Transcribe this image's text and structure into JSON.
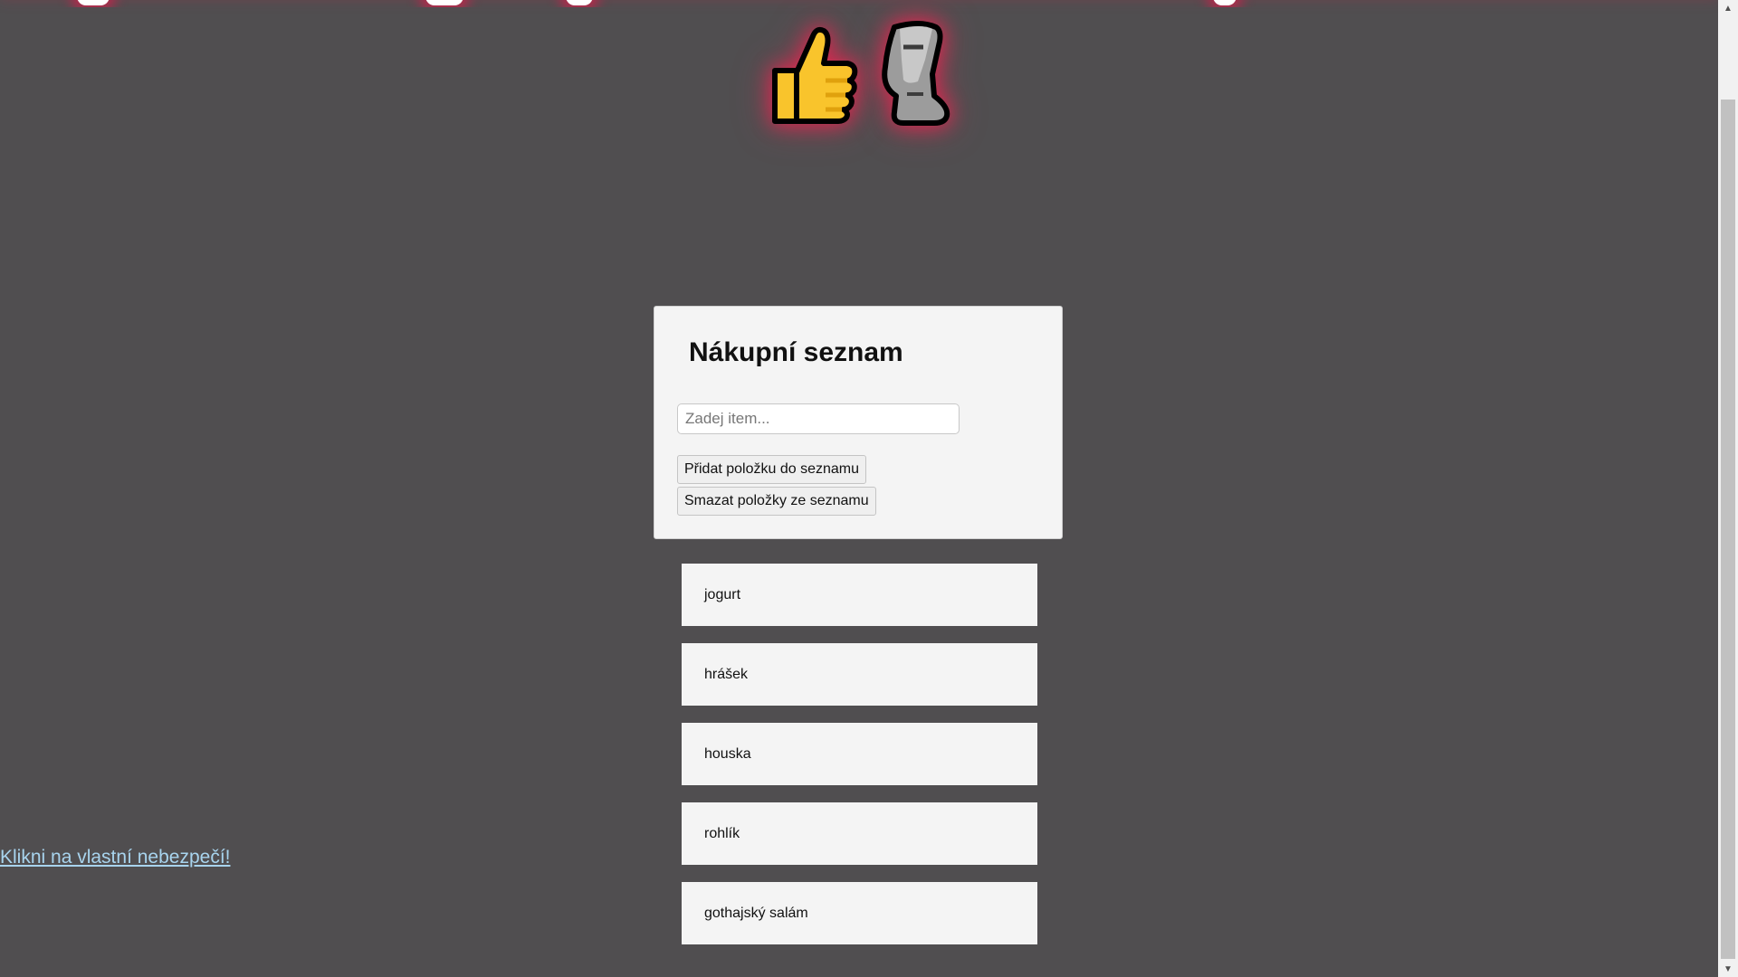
{
  "header": {
    "emojis": [
      "thumbs-up-icon",
      "moai-icon"
    ]
  },
  "card": {
    "title": "Nákupní seznam",
    "input_placeholder": "Zadej item...",
    "input_value": "",
    "add_button": "Přidat položku do seznamu",
    "delete_button": "Smazat položky ze seznamu"
  },
  "list": {
    "items": [
      "jogurt",
      "hrášek",
      "houska",
      "rohlík",
      "gothajský salám"
    ]
  },
  "link": {
    "text": "Klikni na vlastní nebezpečí!"
  },
  "colors": {
    "background": "#504e50",
    "glow": "#d21e46",
    "link": "#a8d4ee",
    "card": "#f4f4f4"
  }
}
